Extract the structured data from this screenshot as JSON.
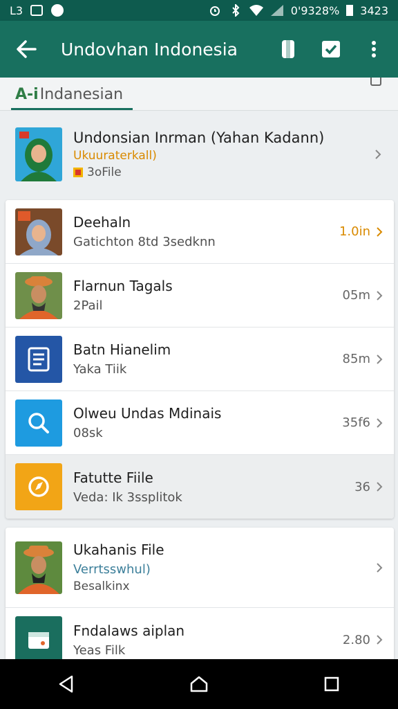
{
  "status_bar": {
    "left_text": "L3",
    "right_text": "0'9328%",
    "time": "3423",
    "icons": [
      "image-icon",
      "check-box-icon",
      "circle-icon",
      "alarm-icon",
      "bluetooth-icon",
      "wifi-icon",
      "signal-icon",
      "battery-icon"
    ]
  },
  "app_bar": {
    "title": "Undovhan Indonesia",
    "icons": [
      "back-arrow-icon",
      "phone-icon",
      "check-square-icon",
      "more-vert-icon"
    ]
  },
  "tab": {
    "prefix": "A-i",
    "label": "Indanesian"
  },
  "featured": {
    "title": "Undonsian Inrman (Yahan Kadann)",
    "subtitle": "Ukuuraterkall)",
    "meta": "3oFile"
  },
  "list_a": [
    {
      "title": "Deehaln",
      "subtitle": "Gatichton 8td 3sedknn",
      "meta": "1.0in",
      "meta_accent": true,
      "thumb": "photo-hijab"
    },
    {
      "title": "Flarnun Tagals",
      "subtitle": "2Pail",
      "meta": "05m",
      "meta_accent": false,
      "thumb": "photo-hat"
    },
    {
      "title": "Batn Hianelim",
      "subtitle": "Yaka Tiik",
      "meta": "85m",
      "meta_accent": false,
      "thumb": "document-icon",
      "color": "#2456a6"
    },
    {
      "title": "Olweu Undas Mdinais",
      "subtitle": "08sk",
      "meta": "35f6",
      "meta_accent": false,
      "thumb": "search-icon",
      "color": "#1e9be0"
    },
    {
      "title": "Fatutte Fiile",
      "subtitle": "Veda: Ik 3ssplitok",
      "meta": "36",
      "meta_accent": false,
      "thumb": "compass-icon",
      "color": "#f2a516",
      "selected": true
    }
  ],
  "list_b": [
    {
      "title": "Ukahanis File",
      "subtitle": "Verrtsswhul)",
      "subtitle2": "Besalkinx",
      "meta": "",
      "thumb": "photo-hat"
    },
    {
      "title": "Fndalaws aiplan",
      "subtitle": "Yeas Filk",
      "meta": "2.80",
      "thumb": "calendar-icon",
      "color": "#1a6e5e"
    }
  ],
  "colors": {
    "status_bar": "#0e5b4e",
    "app_bar": "#18705f",
    "accent_orange": "#d98a00",
    "tab_underline": "#18705f"
  },
  "nav_bar": {
    "icons": [
      "back-triangle-icon",
      "home-icon",
      "recents-icon"
    ]
  }
}
